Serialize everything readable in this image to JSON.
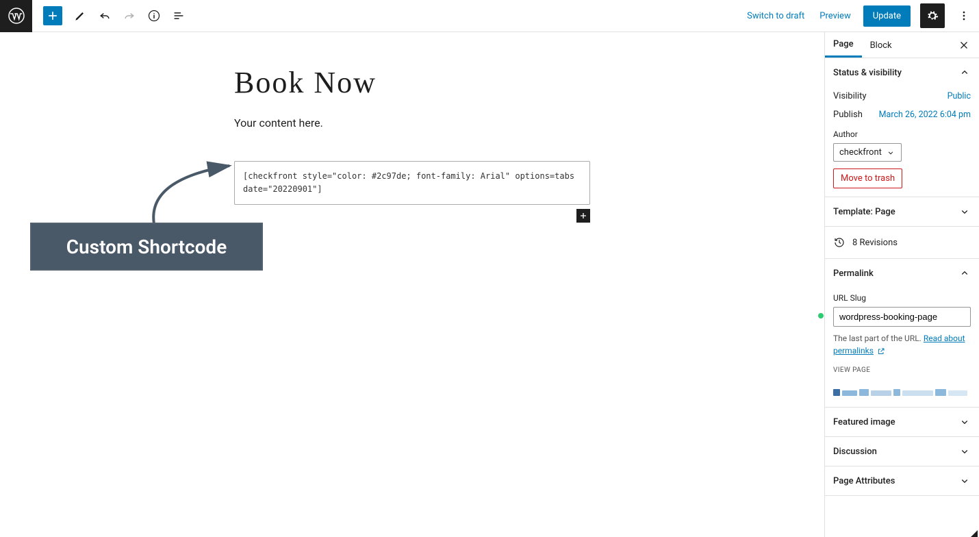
{
  "toolbar": {
    "switch_to_draft": "Switch to draft",
    "preview": "Preview",
    "update": "Update"
  },
  "editor": {
    "title": "Book Now",
    "content_placeholder": "Your content here.",
    "shortcode": "[checkfront style=\"color: #2c97de; font-family: Arial\" options=tabs date=\"20220901\"]"
  },
  "annotation": {
    "label": "Custom Shortcode"
  },
  "sidebar": {
    "tabs": {
      "page": "Page",
      "block": "Block"
    },
    "status": {
      "heading": "Status & visibility",
      "visibility_label": "Visibility",
      "visibility_value": "Public",
      "publish_label": "Publish",
      "publish_value": "March 26, 2022 6:04 pm",
      "author_label": "Author",
      "author_value": "checkfront",
      "trash": "Move to trash"
    },
    "template": {
      "heading": "Template: Page"
    },
    "revisions": {
      "label": "8 Revisions"
    },
    "permalink": {
      "heading": "Permalink",
      "slug_label": "URL Slug",
      "slug_value": "wordpress-booking-page",
      "help_prefix": "The last part of the URL. ",
      "help_link": "Read about permalinks",
      "view_page": "VIEW PAGE"
    },
    "featured": {
      "heading": "Featured image"
    },
    "discussion": {
      "heading": "Discussion"
    },
    "attrs": {
      "heading": "Page Attributes"
    }
  }
}
